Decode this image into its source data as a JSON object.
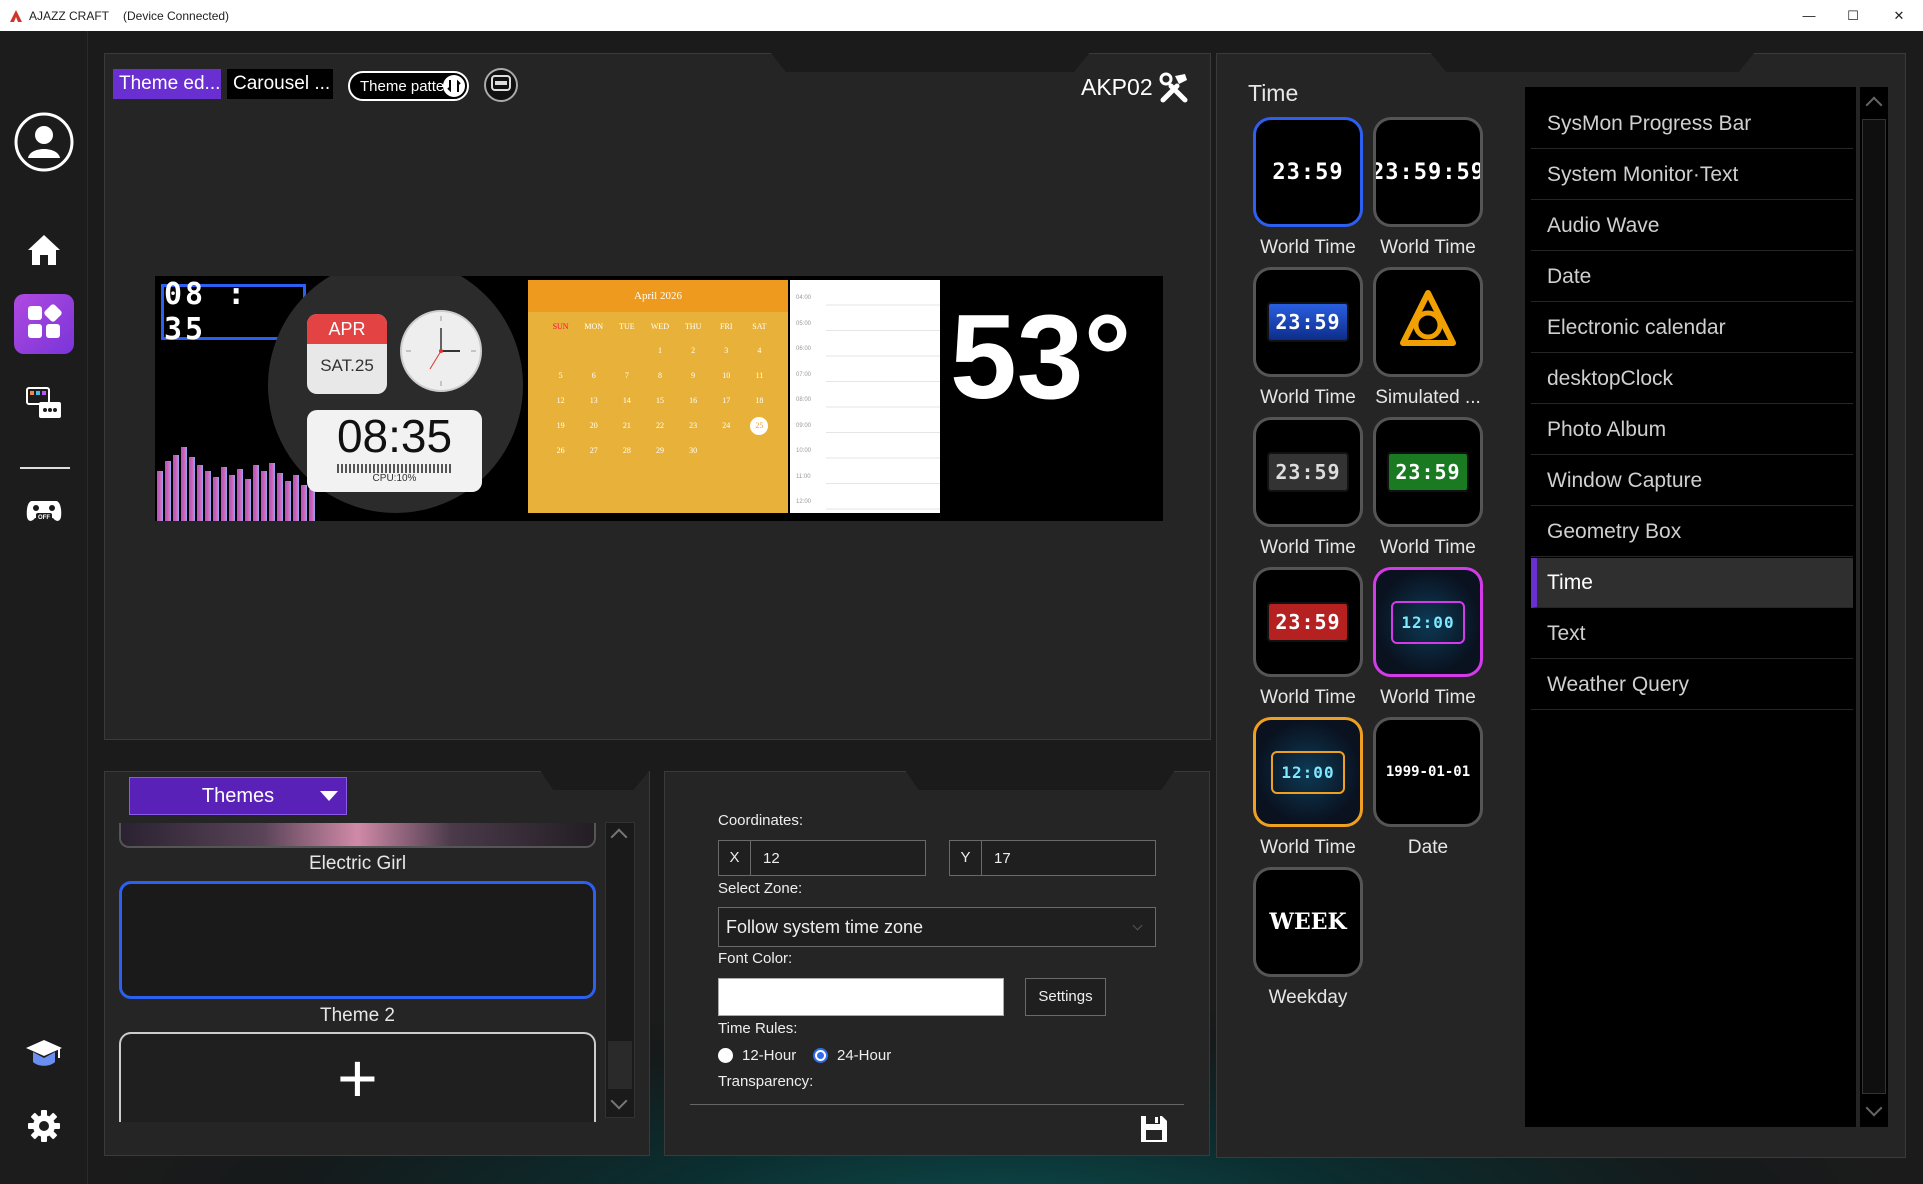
{
  "window": {
    "app_title": "AJAZZ CRAFT",
    "device_status": "(Device Connected)",
    "min_glyph": "—",
    "max_glyph": "☐",
    "close_glyph": "✕"
  },
  "sidebar": {
    "items": [
      {
        "name": "profile",
        "icon": "user-icon"
      },
      {
        "name": "home",
        "icon": "home-icon"
      },
      {
        "name": "widgets",
        "icon": "grid-icon",
        "active": true
      },
      {
        "name": "screen-widgets",
        "icon": "widget-chat-icon"
      },
      {
        "name": "gamepad-off",
        "icon": "gamepad-off-icon",
        "badge": "OFF"
      },
      {
        "name": "tutorial",
        "icon": "graduation-cap-icon"
      },
      {
        "name": "settings",
        "icon": "gear-icon"
      }
    ]
  },
  "editor": {
    "tabs": [
      {
        "label": "Theme ed...",
        "active": true
      },
      {
        "label": "Carousel ...",
        "active": false
      }
    ],
    "pattern_button": "Theme patte",
    "device_name": "AKP02"
  },
  "preview": {
    "clock_text": "08 : 35",
    "month": "APR",
    "day": "SAT.25",
    "digital_time": "08:35",
    "cpu_label": "CPU:10%",
    "calendar_title": "April 2026",
    "calendar_days_header": [
      "SUN",
      "MON",
      "TUE",
      "WED",
      "THU",
      "FRI",
      "SAT"
    ],
    "calendar_rows": [
      [
        "",
        "",
        "",
        "1",
        "2",
        "3",
        "4"
      ],
      [
        "5",
        "6",
        "7",
        "8",
        "9",
        "10",
        "11"
      ],
      [
        "12",
        "13",
        "14",
        "15",
        "16",
        "17",
        "18"
      ],
      [
        "19",
        "20",
        "21",
        "22",
        "23",
        "24",
        "25"
      ],
      [
        "26",
        "27",
        "28",
        "29",
        "30",
        "",
        ""
      ]
    ],
    "schedule_times": [
      "04:00",
      "05:00",
      "06:00",
      "07:00",
      "08:00",
      "09:00",
      "10:00",
      "11:00",
      "12:00"
    ],
    "temperature": "53°"
  },
  "themes_panel": {
    "dropdown_label": "Themes",
    "themes": [
      {
        "name": "Electric Girl"
      },
      {
        "name": "Theme 2"
      }
    ],
    "add_glyph": "+"
  },
  "props_panel": {
    "coordinates_label": "Coordinates:",
    "x_label": "X",
    "x_value": "12",
    "y_label": "Y",
    "y_value": "17",
    "zone_label": "Select Zone:",
    "zone_value": "Follow system time zone",
    "font_color_label": "Font Color:",
    "font_color": "#ffffff",
    "settings_button": "Settings",
    "time_rules_label": "Time Rules:",
    "rule_12": "12-Hour",
    "rule_24": "24-Hour",
    "rule_selected": "24-Hour",
    "transparency_label": "Transparency:"
  },
  "library": {
    "section_title": "Time",
    "tiles": [
      {
        "label": "World Time",
        "display": "23:59",
        "selected": true
      },
      {
        "label": "World Time",
        "display": "23:59:59"
      },
      {
        "label": "World Time",
        "display": "23:59"
      },
      {
        "label": "Simulated ...",
        "display": ""
      },
      {
        "label": "World Time",
        "display": "23:59"
      },
      {
        "label": "World Time",
        "display": "23:59"
      },
      {
        "label": "World Time",
        "display": "23:59"
      },
      {
        "label": "World Time",
        "display": "12:00"
      },
      {
        "label": "World Time",
        "display": "12:00"
      },
      {
        "label": "Date",
        "display": "1999-01-01"
      },
      {
        "label": "Weekday",
        "display": "WEEK"
      }
    ],
    "categories": [
      "SysMon Progress Bar",
      "System Monitor·Text",
      "Audio Wave",
      "Date",
      "Electronic calendar",
      "desktopClock",
      "Photo Album",
      "Window Capture",
      "Geometry Box",
      "Time",
      "Text",
      "Weather Query"
    ],
    "active_category": "Time"
  },
  "colors": {
    "accent": "#6a2fd1",
    "select_blue": "#2d5ff0",
    "radio_blue": "#2d6cf0"
  }
}
